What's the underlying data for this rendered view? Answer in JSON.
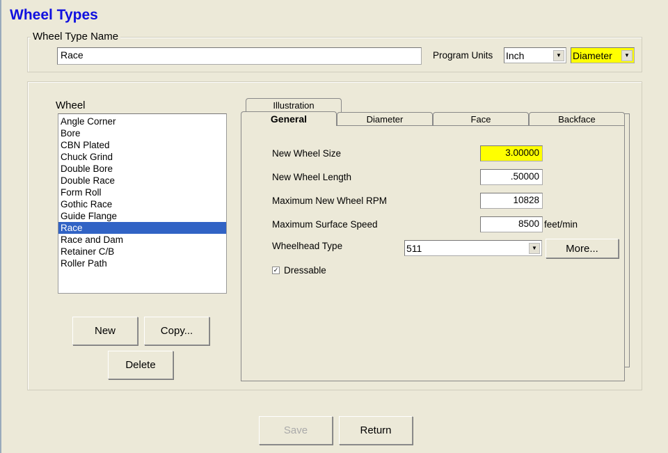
{
  "title": "Wheel Types",
  "name_group": {
    "label": "Wheel Type Name",
    "value": "Race"
  },
  "program_units": {
    "label": "Program Units",
    "units": "Inch",
    "mode": "Diameter"
  },
  "wheel_list": {
    "label": "Wheel",
    "items": [
      "Angle Corner",
      "Bore",
      "CBN Plated",
      "Chuck Grind",
      "Double Bore",
      "Double Race",
      "Form Roll",
      "Gothic Race",
      "Guide Flange",
      "Race",
      "Race and Dam",
      "Retainer C/B",
      "Roller Path"
    ],
    "selected": "Race"
  },
  "buttons": {
    "new": "New",
    "copy": "Copy...",
    "delete": "Delete",
    "save": "Save",
    "return": "Return",
    "more": "More..."
  },
  "tabs": {
    "illustration": "Illustration",
    "general": "General",
    "diameter": "Diameter",
    "face": "Face",
    "backface": "Backface",
    "active": "General"
  },
  "general": {
    "new_wheel_size": {
      "label": "New Wheel Size",
      "value": "3.00000"
    },
    "new_wheel_length": {
      "label": "New Wheel Length",
      "value": ".50000"
    },
    "max_rpm": {
      "label": "Maximum New Wheel RPM",
      "value": "10828"
    },
    "max_surface_speed": {
      "label": "Maximum Surface Speed",
      "value": "8500",
      "unit": "feet/min"
    },
    "wheelhead_type": {
      "label": "Wheelhead Type",
      "value": "511"
    },
    "dressable": {
      "label": "Dressable",
      "checked": true
    }
  },
  "colors": {
    "title": "#1010e0",
    "highlight": "#ffff00",
    "selection": "#3163c5"
  }
}
